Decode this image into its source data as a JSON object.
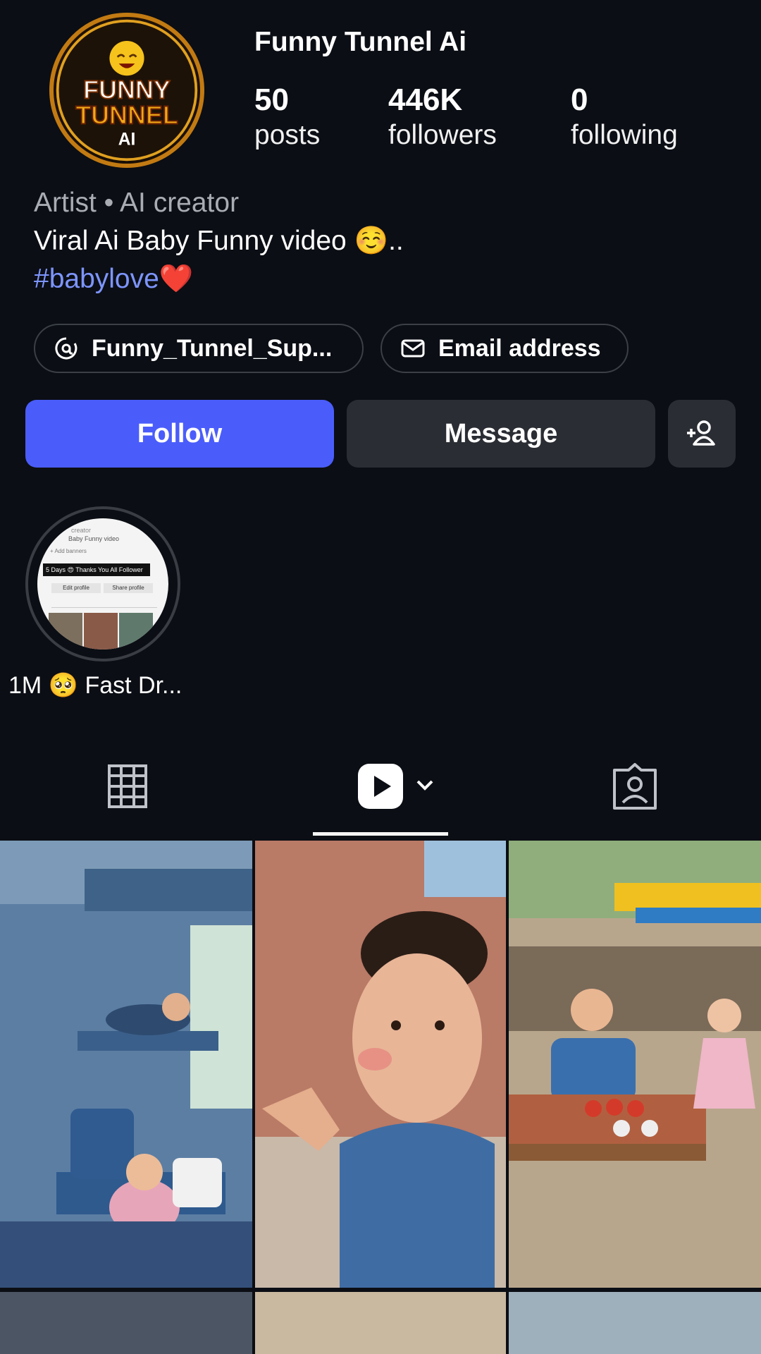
{
  "profile": {
    "username": "Funny Tunnel Ai",
    "avatar_text_top": "FUNNY",
    "avatar_text_mid": "TUNNEL",
    "avatar_text_bottom": "AI",
    "stats": {
      "posts_count": "50",
      "posts_label": "posts",
      "followers_count": "446K",
      "followers_label": "followers",
      "following_count": "0",
      "following_label": "following"
    },
    "category": "Artist • AI creator",
    "bio": "Viral Ai Baby Funny video ☺️..",
    "hashtag": "#babylove",
    "hashtag_emoji": "❤️"
  },
  "links": {
    "threads_label": "Funny_Tunnel_Sup...",
    "email_label": "Email address"
  },
  "actions": {
    "follow_label": "Follow",
    "message_label": "Message"
  },
  "highlights": [
    {
      "label": "1M 🥺 Fast Dr...",
      "thumb_banner": "5 Days 😍 Thanks You All Follower",
      "thumb_edit": "Edit profile",
      "thumb_share": "Share profile",
      "thumb_line1": "creator",
      "thumb_line2": "Baby Funny video",
      "thumb_line3": "+ Add banners"
    }
  ],
  "tabs": [
    {
      "name": "grid",
      "icon": "grid-icon",
      "active": false
    },
    {
      "name": "reels",
      "icon": "reels-icon",
      "active": true
    },
    {
      "name": "tagged",
      "icon": "tagged-icon",
      "active": false
    }
  ],
  "colors": {
    "background": "#0b0e14",
    "follow_button": "#4a5dfb",
    "secondary_button": "#2a2d33",
    "hashtag": "#7d95ff",
    "avatar_ring": "#c27a12"
  }
}
